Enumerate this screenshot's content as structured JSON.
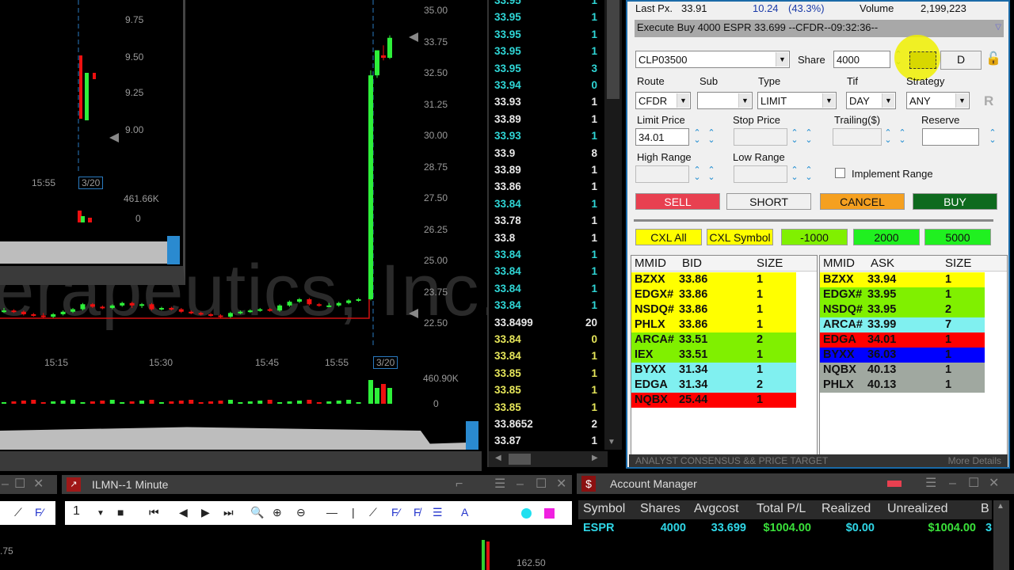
{
  "main_chart": {
    "watermark": "herapeutics, Inc.",
    "y_ticks": [
      "35.00",
      "33.75",
      "32.50",
      "31.25",
      "30.00",
      "28.75",
      "27.50",
      "26.25",
      "25.00",
      "23.75",
      "22.50"
    ],
    "x_ticks": [
      "15:15",
      "15:30",
      "15:45",
      "15:55"
    ],
    "date_marker": "3/20",
    "volume_max": "460.90K",
    "volume_min": "0"
  },
  "inner_chart": {
    "y_ticks": [
      "9.75",
      "9.50",
      "9.25",
      "9.00"
    ],
    "x_ticks": [
      "15:55"
    ],
    "date_marker": "3/20",
    "volume_max": "461.66K",
    "volume_min": "0"
  },
  "chart_data": {
    "type": "candlestick",
    "title": "ESPR",
    "ylim": [
      22.5,
      35.0
    ],
    "candles": [
      [
        23.0,
        23.1,
        22.9,
        23.0
      ],
      [
        23.0,
        23.05,
        22.9,
        22.95
      ],
      [
        22.95,
        23.0,
        22.8,
        22.85
      ],
      [
        22.85,
        22.9,
        22.75,
        22.8
      ],
      [
        22.8,
        22.9,
        22.7,
        22.75
      ],
      [
        22.75,
        22.9,
        22.7,
        22.85
      ],
      [
        22.85,
        23.0,
        22.8,
        22.95
      ],
      [
        22.95,
        23.1,
        22.9,
        23.05
      ],
      [
        23.05,
        23.3,
        23.0,
        23.25
      ],
      [
        23.25,
        23.3,
        23.1,
        23.15
      ],
      [
        23.15,
        23.2,
        23.05,
        23.1
      ],
      [
        23.1,
        23.25,
        23.05,
        23.2
      ],
      [
        23.2,
        23.35,
        23.15,
        23.3
      ],
      [
        23.3,
        23.35,
        23.1,
        23.2
      ],
      [
        23.2,
        23.3,
        23.1,
        23.25
      ],
      [
        23.25,
        23.3,
        23.0,
        23.05
      ],
      [
        23.05,
        23.15,
        23.0,
        23.1
      ],
      [
        23.1,
        23.15,
        23.0,
        23.05
      ],
      [
        23.05,
        23.1,
        22.9,
        22.95
      ],
      [
        22.95,
        23.0,
        22.85,
        22.9
      ],
      [
        22.9,
        22.95,
        22.8,
        22.85
      ],
      [
        22.85,
        22.9,
        22.75,
        22.8
      ],
      [
        22.8,
        22.85,
        22.7,
        22.75
      ],
      [
        22.75,
        22.95,
        22.7,
        22.9
      ],
      [
        22.9,
        23.0,
        22.85,
        22.95
      ],
      [
        22.95,
        23.05,
        22.9,
        23.0
      ],
      [
        23.0,
        23.1,
        22.95,
        23.05
      ],
      [
        23.05,
        23.1,
        22.95,
        23.0
      ],
      [
        23.0,
        23.25,
        22.95,
        23.2
      ],
      [
        23.2,
        23.4,
        23.15,
        23.35
      ],
      [
        23.35,
        23.5,
        23.3,
        23.45
      ],
      [
        23.45,
        23.5,
        23.2,
        23.25
      ],
      [
        23.25,
        23.3,
        23.15,
        23.2
      ],
      [
        23.2,
        23.3,
        23.15,
        23.2
      ],
      [
        23.2,
        23.35,
        23.15,
        23.3
      ],
      [
        23.3,
        23.45,
        23.25,
        23.4
      ],
      [
        23.4,
        23.5,
        23.35,
        23.45
      ],
      [
        23.45,
        32.6,
        23.4,
        32.4
      ],
      [
        32.4,
        33.4,
        32.3,
        33.4
      ],
      [
        33.2,
        33.6,
        33.0,
        33.1
      ],
      [
        33.1,
        34.0,
        33.05,
        33.9
      ]
    ]
  },
  "time_sales": [
    {
      "price": "33.95",
      "size": "1",
      "color": "cyan"
    },
    {
      "price": "33.95",
      "size": "1",
      "color": "cyan"
    },
    {
      "price": "33.95",
      "size": "1",
      "color": "cyan"
    },
    {
      "price": "33.95",
      "size": "1",
      "color": "cyan"
    },
    {
      "price": "33.95",
      "size": "3",
      "color": "cyan"
    },
    {
      "price": "33.94",
      "size": "0",
      "color": "cyan"
    },
    {
      "price": "33.93",
      "size": "1",
      "color": "white"
    },
    {
      "price": "33.89",
      "size": "1",
      "color": "white"
    },
    {
      "price": "33.93",
      "size": "1",
      "color": "cyan"
    },
    {
      "price": "33.9",
      "size": "8",
      "color": "white"
    },
    {
      "price": "33.89",
      "size": "1",
      "color": "white"
    },
    {
      "price": "33.86",
      "size": "1",
      "color": "white"
    },
    {
      "price": "33.84",
      "size": "1",
      "color": "cyan"
    },
    {
      "price": "33.78",
      "size": "1",
      "color": "white"
    },
    {
      "price": "33.8",
      "size": "1",
      "color": "white"
    },
    {
      "price": "33.84",
      "size": "1",
      "color": "cyan"
    },
    {
      "price": "33.84",
      "size": "1",
      "color": "cyan"
    },
    {
      "price": "33.84",
      "size": "1",
      "color": "cyan"
    },
    {
      "price": "33.84",
      "size": "1",
      "color": "cyan"
    },
    {
      "price": "33.8499",
      "size": "20",
      "color": "white"
    },
    {
      "price": "33.84",
      "size": "0",
      "color": "yellow"
    },
    {
      "price": "33.84",
      "size": "1",
      "color": "yellow"
    },
    {
      "price": "33.85",
      "size": "1",
      "color": "yellow"
    },
    {
      "price": "33.85",
      "size": "1",
      "color": "yellow"
    },
    {
      "price": "33.85",
      "size": "1",
      "color": "yellow"
    },
    {
      "price": "33.8652",
      "size": "2",
      "color": "white"
    },
    {
      "price": "33.87",
      "size": "1",
      "color": "white"
    }
  ],
  "ts_colors": {
    "cyan": "#2fd6d6",
    "white": "#e8e8e8",
    "yellow": "#e6e65a"
  },
  "order": {
    "last_px_label": "Last Px.",
    "last_px": "33.91",
    "change": "10.24",
    "change_pct": "(43.3%)",
    "volume_label": "Volume",
    "volume": "2,199,223",
    "message": "Execute Buy 4000 ESPR 33.699 --CFDR--09:32:36--",
    "account": "CLP03500",
    "share_label": "Share",
    "share": "4000",
    "d_button": "D",
    "route_label": "Route",
    "route": "CFDR",
    "sub_label": "Sub",
    "sub": "",
    "type_label": "Type",
    "type": "LIMIT",
    "tif_label": "Tif",
    "tif": "DAY",
    "strategy_label": "Strategy",
    "strategy": "ANY",
    "r_button": "R",
    "limit_label": "Limit Price",
    "limit": "34.01",
    "stop_label": "Stop Price",
    "trailing_label": "Trailing($)",
    "reserve_label": "Reserve",
    "high_label": "High Range",
    "low_label": "Low Range",
    "implement_range": "Implement Range",
    "sell": "SELL",
    "short": "SHORT",
    "cancel": "CANCEL",
    "buy": "BUY",
    "presets": [
      "CXL All",
      "CXL Symbol",
      "-1000",
      "2000",
      "5000"
    ],
    "footer": "ANALYST CONSENSUS && PRICE TARGET",
    "more_details": "More Details"
  },
  "bid_book": {
    "headers": [
      "MMID",
      "BID",
      "SIZE"
    ],
    "rows": [
      [
        "BZXX",
        "33.86",
        "1",
        "#ffff00"
      ],
      [
        "EDGX#",
        "33.86",
        "1",
        "#ffff00"
      ],
      [
        "NSDQ#",
        "33.86",
        "1",
        "#ffff00"
      ],
      [
        "PHLX",
        "33.86",
        "1",
        "#ffff00"
      ],
      [
        "ARCA#",
        "33.51",
        "2",
        "#80f000"
      ],
      [
        "IEX",
        "33.51",
        "1",
        "#80f000"
      ],
      [
        "BYXX",
        "31.34",
        "1",
        "#80f0f0"
      ],
      [
        "EDGA",
        "31.34",
        "2",
        "#80f0f0"
      ],
      [
        "NQBX",
        "25.44",
        "1",
        "#ff0000"
      ]
    ]
  },
  "ask_book": {
    "headers": [
      "MMID",
      "ASK",
      "SIZE"
    ],
    "rows": [
      [
        "BZXX",
        "33.94",
        "1",
        "#ffff00"
      ],
      [
        "EDGX#",
        "33.95",
        "1",
        "#80f000"
      ],
      [
        "NSDQ#",
        "33.95",
        "2",
        "#80f000"
      ],
      [
        "ARCA#",
        "33.99",
        "7",
        "#80f0f0"
      ],
      [
        "EDGA",
        "34.01",
        "1",
        "#ff0000"
      ],
      [
        "BYXX",
        "36.03",
        "1",
        "#0000ff"
      ],
      [
        "NQBX",
        "40.13",
        "1",
        "#a0a8a0"
      ],
      [
        "PHLX",
        "40.13",
        "1",
        "#a0a8a0"
      ]
    ]
  },
  "ilmn": {
    "title": "ILMN--1 Minute",
    "interval": "1",
    "price_label": "162.50",
    "left_price": ".75"
  },
  "account": {
    "title": "Account Manager",
    "headers": [
      "Symbol",
      "Shares",
      "Avgcost",
      "Total P/L",
      "Realized",
      "Unrealized",
      "B"
    ],
    "row": [
      "ESPR",
      "4000",
      "33.699",
      "$1004.00",
      "$0.00",
      "$1004.00",
      "3"
    ]
  }
}
